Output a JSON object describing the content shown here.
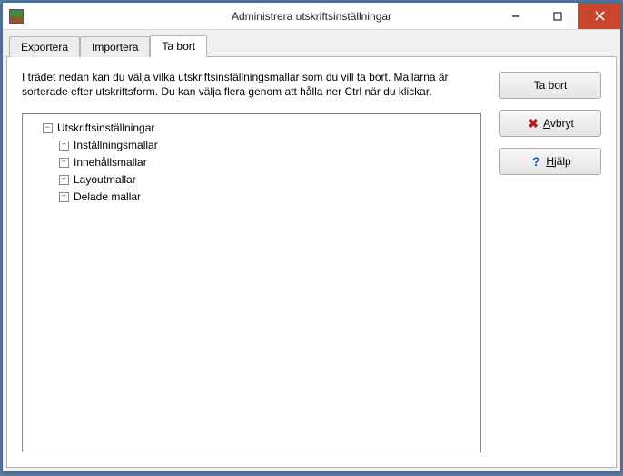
{
  "window": {
    "title": "Administrera utskriftsinställningar"
  },
  "tabs": {
    "export": "Exportera",
    "import": "Importera",
    "delete": "Ta bort"
  },
  "description": "I trädet nedan kan du välja vilka utskriftsinställningsmallar som du vill ta bort. Mallarna är sorterade efter utskriftsform.  Du kan välja flera genom att hålla ner Ctrl när du klickar.",
  "tree": {
    "root": "Utskriftsinställningar",
    "children": {
      "n0": "Inställningsmallar",
      "n1": "Innehållsmallar",
      "n2": "Layoutmallar",
      "n3": "Delade mallar"
    }
  },
  "buttons": {
    "delete": "Ta bort",
    "cancel_rest": "vbryt",
    "help_rest": "jälp"
  }
}
